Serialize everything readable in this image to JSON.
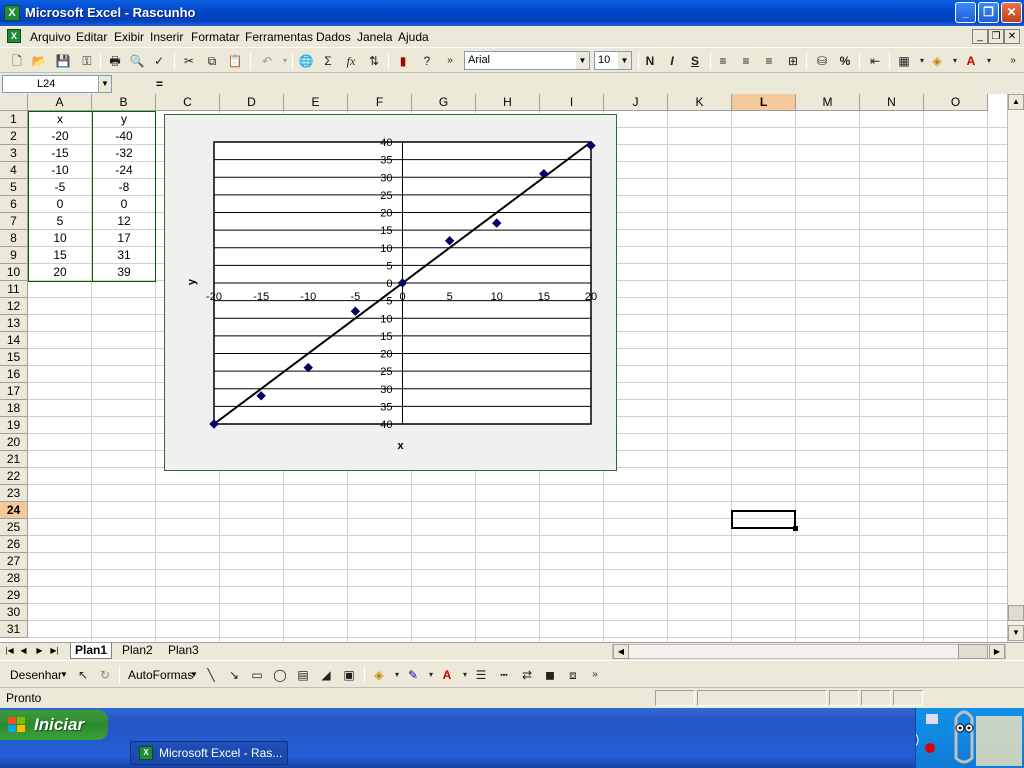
{
  "window": {
    "title": "Microsoft Excel - Rascunho"
  },
  "menu": [
    "Arquivo",
    "Editar",
    "Exibir",
    "Inserir",
    "Formatar",
    "Ferramentas",
    "Dados",
    "Janela",
    "Ajuda"
  ],
  "toolbar": {
    "font_name": "Arial",
    "font_size": "10",
    "bold": "N",
    "italic": "I",
    "underline": "S",
    "percent": "%",
    "sum": "Σ",
    "fx": "fx"
  },
  "formula_bar": {
    "name_box": "L24",
    "equals": "=",
    "content": ""
  },
  "columns": [
    "A",
    "B",
    "C",
    "D",
    "E",
    "F",
    "G",
    "H",
    "I",
    "J",
    "K",
    "L",
    "M",
    "N",
    "O"
  ],
  "active_column": "L",
  "rows": [
    "1",
    "2",
    "3",
    "4",
    "5",
    "6",
    "7",
    "8",
    "9",
    "10",
    "11",
    "12",
    "13",
    "14",
    "15",
    "16",
    "17",
    "18",
    "19",
    "20",
    "21",
    "22",
    "23",
    "24",
    "25",
    "26",
    "27",
    "28",
    "29",
    "30",
    "31"
  ],
  "active_row": "24",
  "table": {
    "headers": [
      "x",
      "y"
    ],
    "rows": [
      [
        "-20",
        "-40"
      ],
      [
        "-15",
        "-32"
      ],
      [
        "-10",
        "-24"
      ],
      [
        "-5",
        "-8"
      ],
      [
        "0",
        "0"
      ],
      [
        "5",
        "12"
      ],
      [
        "10",
        "17"
      ],
      [
        "15",
        "31"
      ],
      [
        "20",
        "39"
      ]
    ]
  },
  "chart_data": {
    "type": "scatter",
    "xlabel": "x",
    "ylabel": "y",
    "xlim": [
      -20,
      20
    ],
    "ylim": [
      -40,
      40
    ],
    "x_ticks": [
      "-20",
      "-15",
      "-10",
      "-5",
      "0",
      "5",
      "10",
      "15",
      "20"
    ],
    "y_ticks": [
      "40",
      "35",
      "30",
      "25",
      "20",
      "15",
      "10",
      "5",
      "0",
      "5",
      "10",
      "15",
      "20",
      "25",
      "30",
      "35",
      "40"
    ],
    "series": [
      {
        "x": [
          -20,
          -15,
          -10,
          -5,
          0,
          5,
          10,
          15,
          20
        ],
        "y": [
          -40,
          -32,
          -24,
          -8,
          0,
          12,
          17,
          31,
          39
        ],
        "marker_color": "#000066"
      }
    ],
    "trendline": {
      "from": [
        -20,
        -40
      ],
      "to": [
        20,
        40
      ]
    },
    "grid": "horizontal",
    "legend": "none"
  },
  "sheets": {
    "tabs": [
      "Plan1",
      "Plan2",
      "Plan3"
    ],
    "active": "Plan1"
  },
  "drawing_toolbar": {
    "draw_menu": "Desenhar",
    "autoshapes": "AutoFormas"
  },
  "status": {
    "text": "Pronto"
  },
  "taskbar": {
    "start": "Iniciar",
    "task": "Microsoft Excel - Ras..."
  },
  "colors": {
    "title_bar": "#0347c8",
    "active_header": "#f5c99a",
    "chart_border": "#2e6b2e",
    "data_border": "#006400"
  }
}
